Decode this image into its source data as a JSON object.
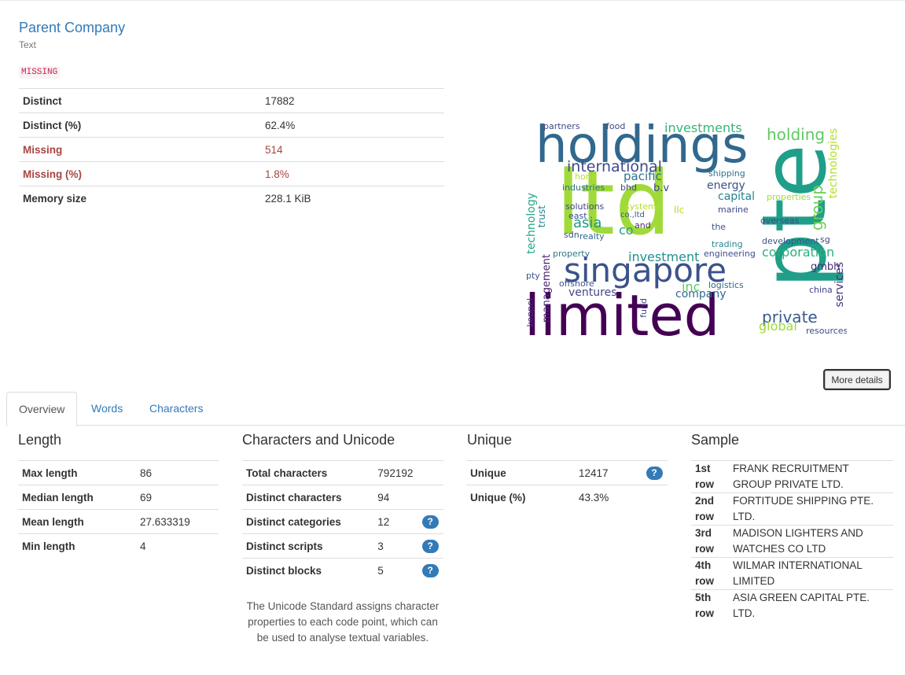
{
  "variable": {
    "name": "Parent Company",
    "type": "Text",
    "missing_badge": "MISSING"
  },
  "stats": [
    {
      "label": "Distinct",
      "value": "17882"
    },
    {
      "label": "Distinct (%)",
      "value": "62.4%"
    },
    {
      "label": "Missing",
      "value": "514"
    },
    {
      "label": "Missing (%)",
      "value": "1.8%"
    },
    {
      "label": "Memory size",
      "value": "228.1 KiB"
    }
  ],
  "wordcloud": {
    "words": [
      {
        "text": "ltd",
        "color": "#a0da39"
      },
      {
        "text": "holdings",
        "color": "#31688e"
      },
      {
        "text": "limited",
        "color": "#440154"
      },
      {
        "text": "pte",
        "color": "#1f9e89"
      },
      {
        "text": "singapore",
        "color": "#3b528b"
      },
      {
        "text": "international",
        "color": "#3e4a89"
      },
      {
        "text": "investments",
        "color": "#35b779"
      },
      {
        "text": "investment",
        "color": "#21918c"
      },
      {
        "text": "holding",
        "color": "#5ec962"
      },
      {
        "text": "group",
        "color": "#6ece58"
      },
      {
        "text": "technologies",
        "color": "#b5de2b"
      },
      {
        "text": "technology",
        "color": "#21a685"
      },
      {
        "text": "corporation",
        "color": "#2ab07f"
      },
      {
        "text": "services",
        "color": "#46327e"
      },
      {
        "text": "private",
        "color": "#365c8d"
      },
      {
        "text": "global",
        "color": "#a0da39"
      },
      {
        "text": "company",
        "color": "#306a8e"
      },
      {
        "text": "ventures",
        "color": "#404688"
      },
      {
        "text": "management",
        "color": "#482475"
      },
      {
        "text": "trust",
        "color": "#26828e"
      },
      {
        "text": "pacific",
        "color": "#2c728e"
      },
      {
        "text": "asia",
        "color": "#1f988b"
      },
      {
        "text": "energy",
        "color": "#3b528b"
      },
      {
        "text": "capital",
        "color": "#26828e"
      },
      {
        "text": "engineering",
        "color": "#3e4c8a"
      },
      {
        "text": "logistics",
        "color": "#31688e"
      },
      {
        "text": "development",
        "color": "#3b528b"
      },
      {
        "text": "gmbh",
        "color": "#472d7b"
      },
      {
        "text": "industries",
        "color": "#2c728e"
      },
      {
        "text": "solutions",
        "color": "#414487"
      },
      {
        "text": "realty",
        "color": "#31688e"
      },
      {
        "text": "property",
        "color": "#2a788e"
      },
      {
        "text": "offshore",
        "color": "#3b528b"
      },
      {
        "text": "keppel",
        "color": "#482878"
      },
      {
        "text": "overseas",
        "color": "#3e4989"
      },
      {
        "text": "trading",
        "color": "#24878e"
      },
      {
        "text": "china",
        "color": "#404688"
      },
      {
        "text": "inc",
        "color": "#5ec962"
      },
      {
        "text": "co",
        "color": "#1f9e89"
      },
      {
        "text": "sdn",
        "color": "#3b528b"
      },
      {
        "text": "east",
        "color": "#3b528b"
      },
      {
        "text": "shipping",
        "color": "#2c728e"
      },
      {
        "text": "marine",
        "color": "#3e4989"
      },
      {
        "text": "resources",
        "color": "#3e4989"
      },
      {
        "text": "food",
        "color": "#404688"
      },
      {
        "text": "partners",
        "color": "#3e4989"
      },
      {
        "text": "pty",
        "color": "#3b528b"
      },
      {
        "text": "and",
        "color": "#472d7b"
      },
      {
        "text": "the",
        "color": "#3b528b"
      },
      {
        "text": "llc",
        "color": "#b5de2b"
      },
      {
        "text": "b.v",
        "color": "#3e4989"
      },
      {
        "text": "systems",
        "color": "#b5de2b"
      },
      {
        "text": "properties",
        "color": "#a0da39"
      },
      {
        "text": "sg",
        "color": "#3e4989"
      },
      {
        "text": "hong",
        "color": "#b5de2b"
      },
      {
        "text": "co.,ltd",
        "color": "#3b528b"
      },
      {
        "text": "bhd",
        "color": "#3e4989"
      },
      {
        "text": "fund",
        "color": "#3e4989"
      }
    ]
  },
  "more_details_label": "More details",
  "tabs": [
    {
      "label": "Overview"
    },
    {
      "label": "Words"
    },
    {
      "label": "Characters"
    }
  ],
  "length": {
    "title": "Length",
    "rows": [
      {
        "label": "Max length",
        "value": "86"
      },
      {
        "label": "Median length",
        "value": "69"
      },
      {
        "label": "Mean length",
        "value": "27.633319"
      },
      {
        "label": "Min length",
        "value": "4"
      }
    ]
  },
  "characters": {
    "title": "Characters and Unicode",
    "rows": [
      {
        "label": "Total characters",
        "value": "792192",
        "help": ""
      },
      {
        "label": "Distinct characters",
        "value": "94",
        "help": ""
      },
      {
        "label": "Distinct categories",
        "value": "12",
        "help": "?"
      },
      {
        "label": "Distinct scripts",
        "value": "3",
        "help": "?"
      },
      {
        "label": "Distinct blocks",
        "value": "5",
        "help": "?"
      }
    ],
    "note": "The Unicode Standard assigns character properties to each code point, which can be used to analyse textual variables."
  },
  "unique": {
    "title": "Unique",
    "rows": [
      {
        "label": "Unique",
        "value": "12417",
        "help": "?"
      },
      {
        "label": "Unique (%)",
        "value": "43.3%",
        "help": ""
      }
    ]
  },
  "sample": {
    "title": "Sample",
    "rows": [
      {
        "label": "1st row",
        "value": "FRANK RECRUITMENT GROUP PRIVATE LTD."
      },
      {
        "label": "2nd row",
        "value": "FORTITUDE SHIPPING PTE. LTD."
      },
      {
        "label": "3rd row",
        "value": "MADISON LIGHTERS AND WATCHES CO LTD"
      },
      {
        "label": "4th row",
        "value": "WILMAR INTERNATIONAL LIMITED"
      },
      {
        "label": "5th row",
        "value": "ASIA GREEN CAPITAL PTE. LTD."
      }
    ]
  }
}
